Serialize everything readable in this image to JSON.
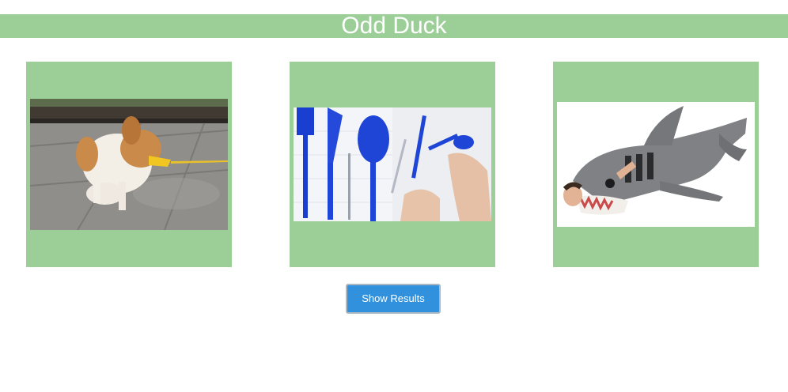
{
  "header": {
    "title": "Odd Duck",
    "bg_color": "#9ccf98"
  },
  "products": [
    {
      "subject": "chihuahua-duck-muzzle-photo"
    },
    {
      "subject": "blue-pen-cutlery-photo"
    },
    {
      "subject": "shark-sleeping-bag-photo"
    }
  ],
  "actions": {
    "show_results_label": "Show Results",
    "button_color": "#3191dd"
  }
}
